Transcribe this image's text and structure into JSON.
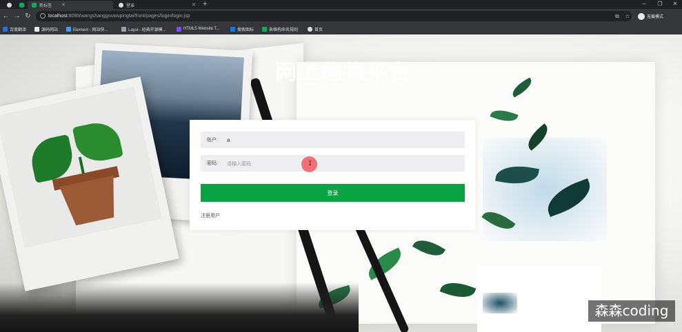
{
  "browser": {
    "tabs": [
      {
        "label": "",
        "active": false
      },
      {
        "label": "",
        "active": false
      },
      {
        "label": "新标签",
        "active": true
      },
      {
        "label": "登录",
        "active": false
      }
    ],
    "url_host": "localhost",
    "url_rest": ":8080/wangshanggouwupingtai/front/pages/login/login.jsp",
    "profile_label": "无痕模式",
    "bookmarks": [
      {
        "label": "百度翻译",
        "color": "#2b6be6"
      },
      {
        "label": "源码网站",
        "color": "#e8eaed"
      },
      {
        "label": "Element - 网站快...",
        "color": "#409eff"
      },
      {
        "label": "Layui - 经典开源模...",
        "color": "#9aa0a6"
      },
      {
        "label": "HTML5 Website T...",
        "color": "#7c4dff"
      },
      {
        "label": "搜索图标",
        "color": "#1a73e8"
      },
      {
        "label": "表格构命名规则",
        "color": "#0fa958"
      },
      {
        "label": "首页",
        "color": "#dadce0"
      }
    ]
  },
  "page": {
    "title": "网上购物平台",
    "login": {
      "account_label": "账户:",
      "account_value": "a",
      "password_label": "密码:",
      "password_placeholder": "请输入密码",
      "submit_label": "登录",
      "register_label": "注册用户"
    }
  },
  "watermark": "森森coding",
  "colors": {
    "primary_button": "#0aa344",
    "input_bg": "#eeeef0",
    "cursor_highlight": "#ee5a62"
  }
}
